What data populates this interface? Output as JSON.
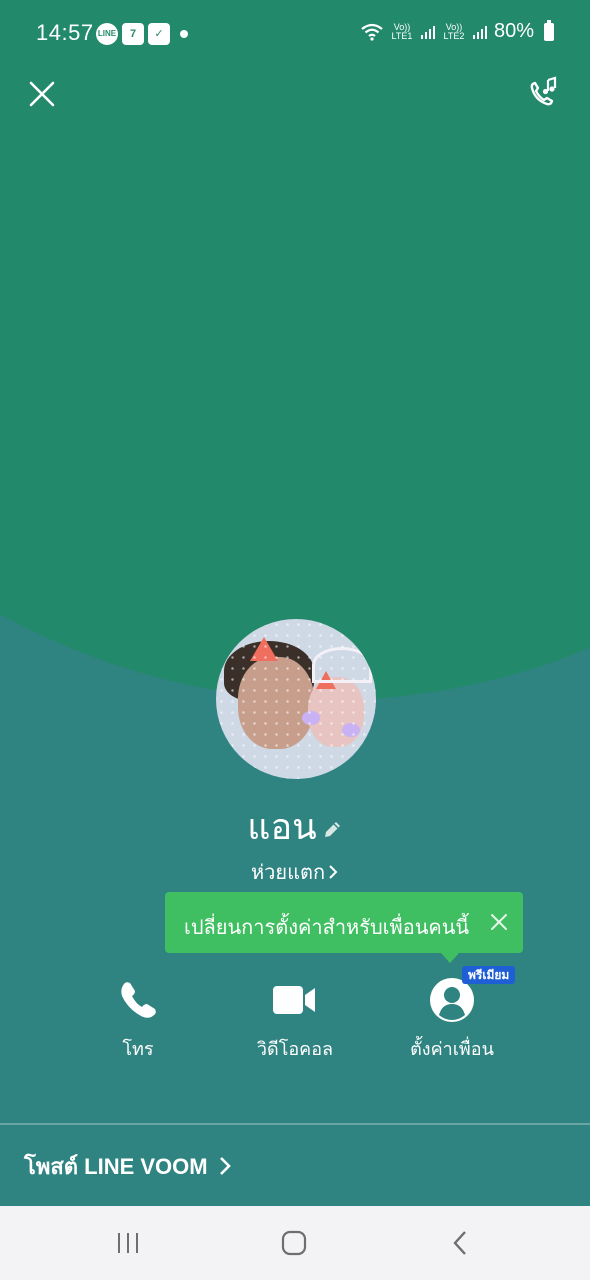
{
  "status_bar": {
    "time": "14:57",
    "notif_line": "LINE",
    "notif_711": "7",
    "network_1": "Vo)) LTE1",
    "network_2": "Vo)) LTE2",
    "battery": "80%"
  },
  "profile": {
    "name": "แอน",
    "status_message": "ห่วยแตก"
  },
  "tooltip": {
    "text": "เปลี่ยนการตั้งค่าสำหรับเพื่อนคนนี้"
  },
  "actions": [
    {
      "label": "โทร",
      "icon": "phone-icon"
    },
    {
      "label": "วิดีโอคอล",
      "icon": "video-camera-icon"
    },
    {
      "label": "ตั้งค่าเพื่อน",
      "icon": "person-icon"
    }
  ],
  "premium_badge": "พรีเมียม",
  "voom": {
    "label": "โพสต์ LINE VOOM"
  },
  "colors": {
    "bg_top": "#22896a",
    "bg_bottom": "#2f8482",
    "tooltip": "#3fbf62",
    "badge": "#1f5fd6",
    "navbar": "#f3f3f5"
  }
}
